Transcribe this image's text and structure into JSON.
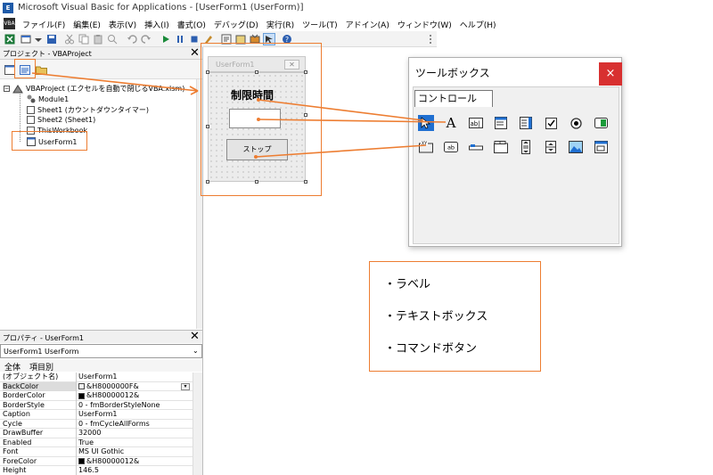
{
  "window": {
    "title": "Microsoft Visual Basic for Applications - [UserForm1 (UserForm)]"
  },
  "menu": [
    "ファイル(F)",
    "編集(E)",
    "表示(V)",
    "挿入(I)",
    "書式(O)",
    "デバッグ(D)",
    "実行(R)",
    "ツール(T)",
    "アドイン(A)",
    "ウィンドウ(W)",
    "ヘルプ(H)"
  ],
  "project_panel": {
    "title": "プロジェクト - VBAProject",
    "tree": {
      "root": "VBAProject (エクセルを自動で閉じるVBA.xlsm)",
      "items": [
        "Module1",
        "Sheet1 (カウントダウンタイマー)",
        "Sheet2 (Sheet1)",
        "ThisWorkbook",
        "UserForm1"
      ]
    }
  },
  "properties_panel": {
    "title": "プロパティ - UserForm1",
    "object_select": "UserForm1 UserForm",
    "tabs": [
      "全体",
      "項目別"
    ],
    "rows": [
      {
        "key": "(オブジェクト名)",
        "value": "UserForm1"
      },
      {
        "key": "BackColor",
        "value": "&H8000000F&",
        "swatch": "#f0f0f0"
      },
      {
        "key": "BorderColor",
        "value": "&H80000012&",
        "swatch": "#000000"
      },
      {
        "key": "BorderStyle",
        "value": "0 - fmBorderStyleNone"
      },
      {
        "key": "Caption",
        "value": "UserForm1"
      },
      {
        "key": "Cycle",
        "value": "0 - fmCycleAllForms"
      },
      {
        "key": "DrawBuffer",
        "value": "32000"
      },
      {
        "key": "Enabled",
        "value": "True"
      },
      {
        "key": "Font",
        "value": "MS UI Gothic"
      },
      {
        "key": "ForeColor",
        "value": "&H80000012&",
        "swatch": "#000000"
      },
      {
        "key": "Height",
        "value": "146.5"
      }
    ]
  },
  "userform": {
    "title": "UserForm1",
    "close": "✕",
    "label": "制限時間",
    "button": "ストップ"
  },
  "toolbox": {
    "title": "ツールボックス",
    "close": "×",
    "tab": "コントロール",
    "tools_row1": [
      "select-arrow",
      "label",
      "textbox",
      "combobox",
      "listbox",
      "checkbox",
      "optionbutton",
      "togglebutton"
    ],
    "tools_row2": [
      "frame",
      "commandbutton",
      "tabstrip",
      "multipage",
      "scrollbar",
      "spinbutton",
      "image",
      "refedit"
    ]
  },
  "legend": {
    "items": [
      "・ラベル",
      "・テキストボックス",
      "・コマンドボタン"
    ]
  },
  "colors": {
    "annotation": "#ed7d31",
    "toolbox_close": "#d83030"
  }
}
